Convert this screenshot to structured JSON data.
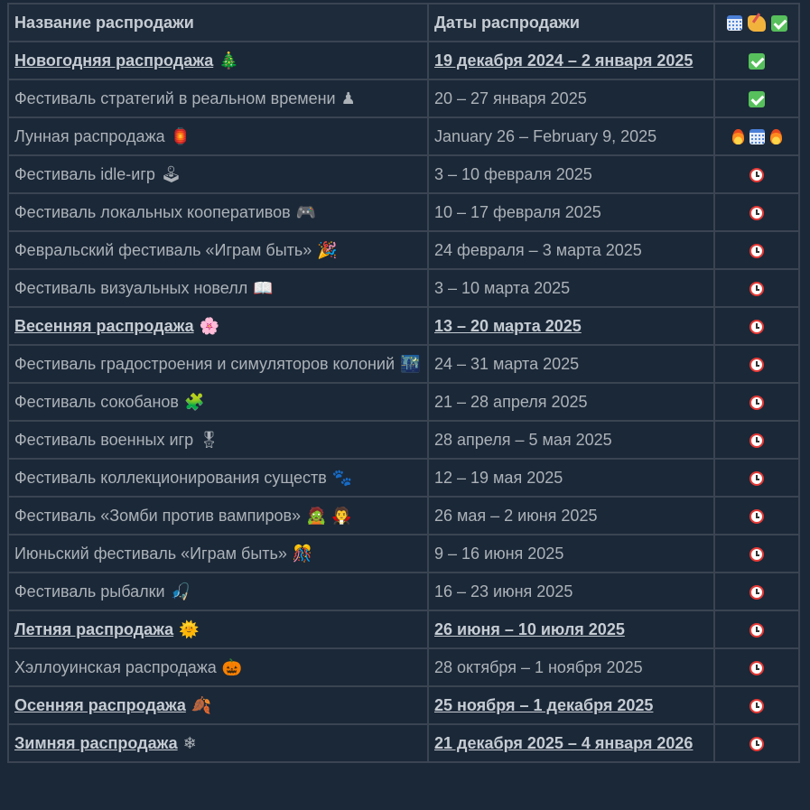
{
  "headers": {
    "name": "Название распродажи",
    "dates": "Даты распродажи"
  },
  "header_icons": [
    "calendar-icon",
    "writing-hand-icon",
    "check-mark-icon"
  ],
  "colors": {
    "background": "#1b2838",
    "border": "#3a4452",
    "text": "#acb2b8",
    "text_bold": "#c6ccd3",
    "check_green": "#57c05c",
    "alarm_red": "#e53935"
  },
  "rows": [
    {
      "name": "Новогодняя распродажа",
      "emoji": "🎄",
      "emoji_name": "christmas-tree-icon",
      "dates": "19 декабря 2024 – 2 января 2025",
      "major": true,
      "status": "done"
    },
    {
      "name": "Фестиваль стратегий в реальном времени",
      "emoji": "♟",
      "emoji_name": "chess-pawn-icon",
      "dates": "20 – 27 января 2025",
      "major": false,
      "status": "done"
    },
    {
      "name": "Лунная распродажа",
      "emoji": "🏮",
      "emoji_name": "lantern-icon",
      "dates": "January 26 – February 9, 2025",
      "major": false,
      "status": "current"
    },
    {
      "name": "Фестиваль idle-игр",
      "emoji": "🕹",
      "emoji_name": "joystick-icon",
      "dates": "3 – 10 февраля 2025",
      "major": false,
      "status": "upcoming"
    },
    {
      "name": "Фестиваль локальных кооперативов",
      "emoji": "🎮",
      "emoji_name": "game-controller-icon",
      "dates": "10 – 17 февраля 2025",
      "major": false,
      "status": "upcoming"
    },
    {
      "name": "Февральский фестиваль «Играм быть»",
      "emoji": "🎉",
      "emoji_name": "party-popper-icon",
      "dates": "24 февраля – 3 марта 2025",
      "major": false,
      "status": "upcoming"
    },
    {
      "name": "Фестиваль визуальных новелл",
      "emoji": "📖",
      "emoji_name": "open-book-icon",
      "dates": "3 – 10 марта 2025",
      "major": false,
      "status": "upcoming"
    },
    {
      "name": "Весенняя распродажа",
      "emoji": "🌸",
      "emoji_name": "cherry-blossom-icon",
      "dates": "13 – 20 марта 2025",
      "major": true,
      "status": "upcoming"
    },
    {
      "name": "Фестиваль градостроения и симуляторов колоний",
      "emoji": "🌃",
      "emoji_name": "night-city-icon",
      "dates": "24 – 31 марта 2025",
      "major": false,
      "status": "upcoming"
    },
    {
      "name": "Фестиваль сокобанов",
      "emoji": "🧩",
      "emoji_name": "puzzle-piece-icon",
      "dates": "21 – 28 апреля 2025",
      "major": false,
      "status": "upcoming"
    },
    {
      "name": "Фестиваль военных игр",
      "emoji": "🎖",
      "emoji_name": "military-medal-icon",
      "dates": "28 апреля – 5 мая 2025",
      "major": false,
      "status": "upcoming"
    },
    {
      "name": "Фестиваль коллекционирования существ",
      "emoji": "🐾",
      "emoji_name": "paw-prints-icon",
      "dates": "12 – 19 мая 2025",
      "major": false,
      "status": "upcoming"
    },
    {
      "name": "Фестиваль «Зомби против вампиров»",
      "emoji": "🧟 🧛",
      "emoji_name": "zombie-vampire-icon",
      "dates": "26 мая – 2 июня 2025",
      "major": false,
      "status": "upcoming"
    },
    {
      "name": "Июньский фестиваль «Играм быть»",
      "emoji": "🎊",
      "emoji_name": "confetti-ball-icon",
      "dates": "9 – 16 июня 2025",
      "major": false,
      "status": "upcoming"
    },
    {
      "name": "Фестиваль рыбалки",
      "emoji": "🎣",
      "emoji_name": "fishing-pole-icon",
      "dates": "16 – 23 июня 2025",
      "major": false,
      "status": "upcoming"
    },
    {
      "name": "Летняя распродажа",
      "emoji": "🌞",
      "emoji_name": "sun-icon",
      "dates": "26 июня – 10 июля 2025",
      "major": true,
      "status": "upcoming"
    },
    {
      "name": "Хэллоуинская распродажа",
      "emoji": "🎃",
      "emoji_name": "jack-o-lantern-icon",
      "dates": "28 октября – 1 ноября 2025",
      "major": false,
      "status": "upcoming"
    },
    {
      "name": "Осенняя распродажа",
      "emoji": "🍂",
      "emoji_name": "fallen-leaf-icon",
      "dates": "25 ноября – 1 декабря 2025",
      "major": true,
      "status": "upcoming"
    },
    {
      "name": "Зимняя распродажа",
      "emoji": "❄",
      "emoji_name": "snowflake-icon",
      "dates": "21 декабря 2025 – 4 января 2026",
      "major": true,
      "status": "upcoming"
    }
  ]
}
